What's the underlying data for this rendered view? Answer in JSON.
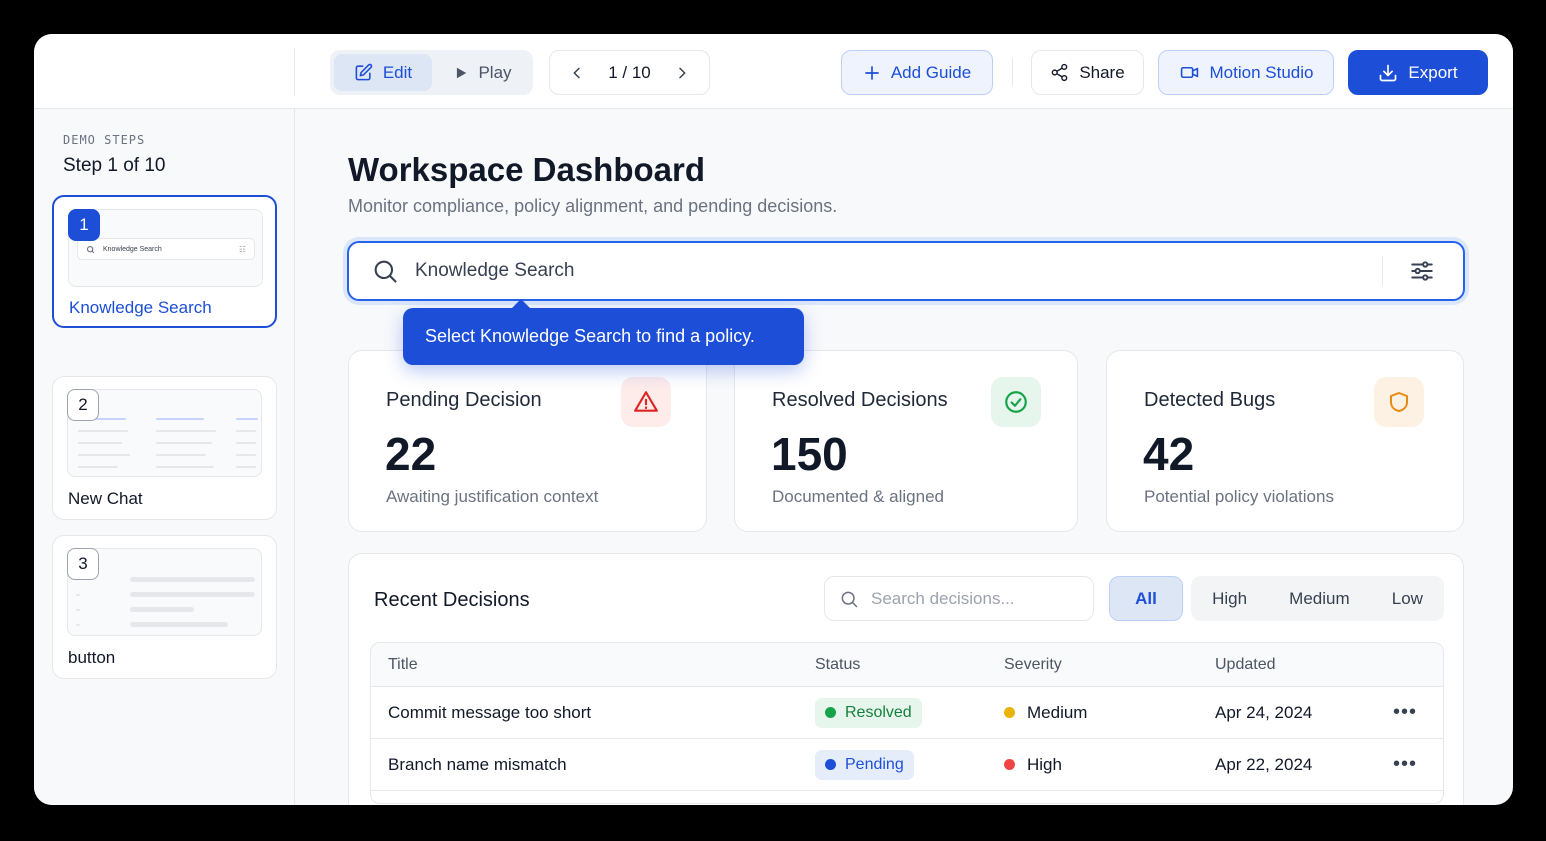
{
  "toolbar": {
    "edit_label": "Edit",
    "play_label": "Play",
    "pager": "1 / 10",
    "add_guide_label": "Add Guide",
    "share_label": "Share",
    "motion_studio_label": "Motion Studio",
    "export_label": "Export"
  },
  "sidebar": {
    "kicker": "DEMO STEPS",
    "step_text": "Step 1 of 10",
    "steps": [
      {
        "number": "1",
        "label": "Knowledge Search",
        "thumb_text": "Knowledge Search"
      },
      {
        "number": "2",
        "label": "New Chat"
      },
      {
        "number": "3",
        "label": "button"
      }
    ]
  },
  "main": {
    "title": "Workspace Dashboard",
    "subtitle": "Monitor compliance, policy alignment, and pending decisions.",
    "search_value": "Knowledge Search",
    "tooltip": "Select Knowledge Search to find a policy.",
    "stats": [
      {
        "title": "Pending Decision",
        "value": "22",
        "sub": "Awaiting justification context",
        "icon": "warning-icon",
        "color": "#dc2626",
        "bg": "#fdecea"
      },
      {
        "title": "Resolved Decisions",
        "value": "150",
        "sub": "Documented & aligned",
        "icon": "check-circle-icon",
        "color": "#16a34a",
        "bg": "#e6f6ec"
      },
      {
        "title": "Detected Bugs",
        "value": "42",
        "sub": "Potential policy violations",
        "icon": "shield-icon",
        "color": "#ea8a16",
        "bg": "#fdf1e3"
      }
    ]
  },
  "recent": {
    "title": "Recent Decisions",
    "search_placeholder": "Search decisions...",
    "filters": {
      "all": "All",
      "high": "High",
      "medium": "Medium",
      "low": "Low"
    },
    "columns": {
      "title": "Title",
      "status": "Status",
      "severity": "Severity",
      "updated": "Updated"
    },
    "rows": [
      {
        "title": "Commit message too short",
        "status": "Resolved",
        "severity": "Medium",
        "updated": "Apr 24, 2024"
      },
      {
        "title": "Branch name mismatch",
        "status": "Pending",
        "severity": "High",
        "updated": "Apr 22, 2024"
      }
    ]
  },
  "colors": {
    "accent": "#1d4ed8",
    "resolved": "#16a34a",
    "pending": "#1d4ed8",
    "medium": "#eab308",
    "high": "#ef4444"
  }
}
